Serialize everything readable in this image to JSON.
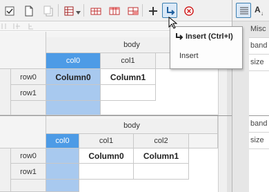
{
  "toolbar": {
    "icons": [
      "toggle-checkbox-icon",
      "new-document-icon",
      "copy-icon",
      "dataset-icon",
      "dropdown-arrow-icon",
      "insert-column-icon",
      "insert-header-icon",
      "insert-row-icon",
      "add-icon",
      "insert-icon",
      "delete-icon"
    ]
  },
  "tooltip": {
    "title": "Insert (Ctrl+I)",
    "description": "Insert"
  },
  "grid1": {
    "band": "body",
    "columns": [
      "col0",
      "col1"
    ],
    "rows": [
      "row0",
      "row1"
    ],
    "cells": [
      "Column0",
      "Column1"
    ]
  },
  "grid2": {
    "band": "body",
    "columns": [
      "col0",
      "col1",
      "col2"
    ],
    "rows": [
      "row0",
      "row1"
    ],
    "cells": [
      "Column0",
      "Column1"
    ]
  },
  "properties": {
    "header": "Misc",
    "items": [
      "band",
      "size"
    ],
    "items2": [
      "band",
      "size"
    ]
  },
  "colors": {
    "selected_header": "#4d9be6",
    "selected_body": "#a8c9ef",
    "active_button_border": "#3c7fb1"
  }
}
